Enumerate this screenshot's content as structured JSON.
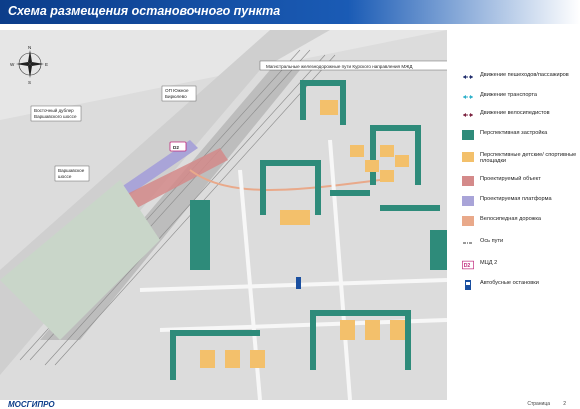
{
  "header": {
    "title": "Схема размещения остановочного пункта"
  },
  "compass": {
    "north": "N",
    "south": "S",
    "east": "E",
    "west": "W"
  },
  "map_labels": {
    "railway": "Магистральные железнодорожные пути Курского направления МЖД",
    "station": "ОП Южное Бирюлево",
    "station_short_1": "ОП Южное",
    "station_short_2": "Бирюлево",
    "east_backup_1": "Восточный дублер",
    "east_backup_2": "Варшавского шоссе",
    "highway_1": "Варшавское",
    "highway_2": "шоссе",
    "badge": "D2"
  },
  "legend": [
    {
      "label": "Движение пешеходов/пассажиров",
      "color": "#1e2a6a",
      "icon": "pedestrian-arrow-icon"
    },
    {
      "label": "Движение транспорта",
      "color": "#2bb0c9",
      "icon": "transport-arrow-icon"
    },
    {
      "label": "Движение велосипедистов",
      "color": "#7a1f3d",
      "icon": "bicycle-arrow-icon"
    },
    {
      "label": "Перспективная застройка",
      "color": "#2e8b7a",
      "icon": "planned-buildings-swatch"
    },
    {
      "label": "Перспективные детские/ спортивные площадки",
      "color": "#f3c06b",
      "icon": "playground-swatch"
    },
    {
      "label": "Проектируемый объект",
      "color": "#d48a8a",
      "icon": "designed-object-swatch"
    },
    {
      "label": "Проектируемая платформа",
      "color": "#a9a4d8",
      "icon": "platform-swatch"
    },
    {
      "label": "Велосипедная дорожка",
      "color": "#e9a98a",
      "icon": "bike-path-swatch"
    },
    {
      "label": "Ось пути",
      "color": "#333333",
      "icon": "track-axis-icon"
    },
    {
      "label": "МЦД 2",
      "color": "#c0267a",
      "icon": "mcd-badge-icon",
      "badge": "D2"
    },
    {
      "label": "Автобусные остановки",
      "color": "#1a4fa0",
      "icon": "bus-stop-icon"
    }
  ],
  "footer": {
    "logo": "МОСГИПРО",
    "page_label": "Страница",
    "page_number": "2"
  }
}
